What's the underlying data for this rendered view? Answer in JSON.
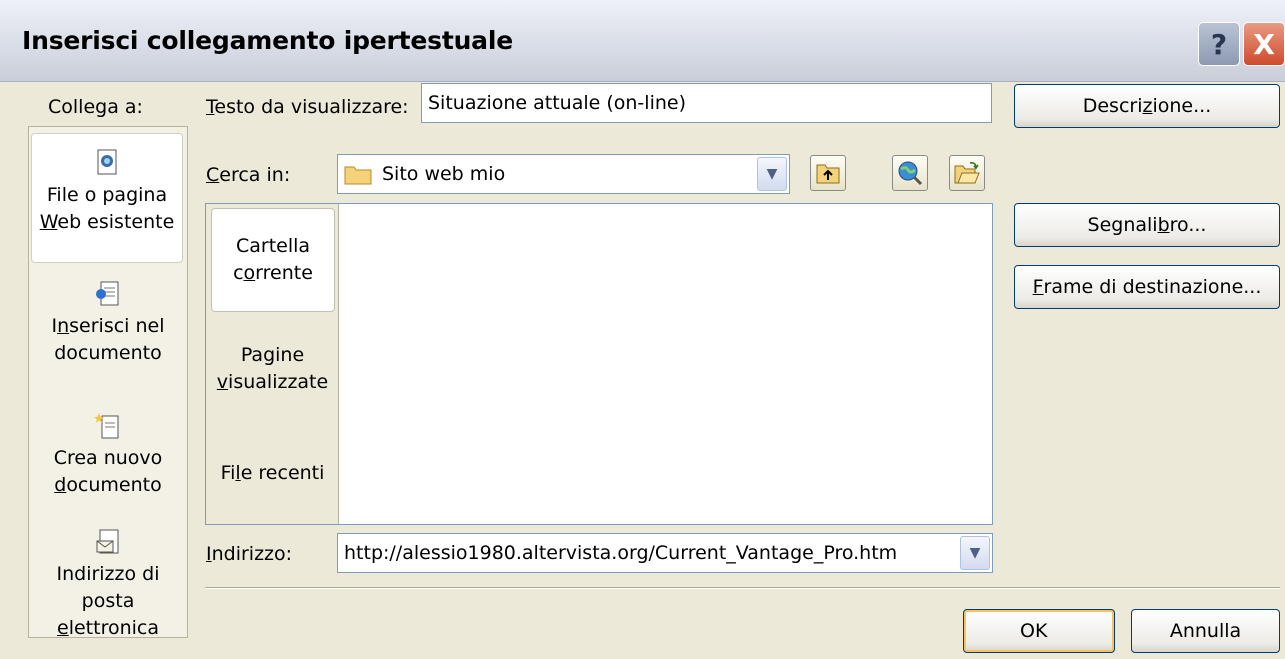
{
  "window": {
    "title": "Inserisci collegamento ipertestuale",
    "help_glyph": "?",
    "close_glyph": "X"
  },
  "linkbar": {
    "heading": "Collega a:",
    "items": [
      {
        "icon": "existing-file-icon",
        "line1": "File o pagina",
        "line2_accel": "W",
        "line2_rest": "eb esistente"
      },
      {
        "icon": "place-in-document-icon",
        "line1_pre": "I",
        "line1_accel": "n",
        "line1_rest": "serisci nel",
        "line2": "documento"
      },
      {
        "icon": "new-document-icon",
        "line1": "Crea nuovo",
        "line2_accel": "d",
        "line2_rest": "ocumento"
      },
      {
        "icon": "email-address-icon",
        "line1": "Indirizzo di",
        "line2": "posta",
        "line3_accel": "e",
        "line3_rest": "lettronica"
      }
    ]
  },
  "display_text": {
    "label_accel": "T",
    "label_rest": "esto da visualizzare:",
    "value": "Situazione attuale (on-line)"
  },
  "look_in": {
    "label_accel": "C",
    "label_rest": "erca in:",
    "value": "Sito web mio",
    "folder_icon": "folder-icon",
    "up_icon": "up-one-folder-icon",
    "browse_web_icon": "browse-web-icon",
    "browse_file_icon": "browse-file-icon"
  },
  "browse_tabs": [
    {
      "line1": "Cartella",
      "line2_pre": "c",
      "line2_accel": "o",
      "line2_rest": "rrente"
    },
    {
      "line1": "Pagine",
      "line2_accel": "v",
      "line2_rest": "isualizzate"
    },
    {
      "pre": "Fi",
      "accel": "l",
      "rest": "e recenti"
    }
  ],
  "address": {
    "label_accel": "I",
    "label_rest": "ndirizzo:",
    "value": "http://alessio1980.altervista.org/Current_Vantage_Pro.htm"
  },
  "buttons": {
    "description": {
      "pre": "Descri",
      "accel": "z",
      "rest": "ione..."
    },
    "bookmark": {
      "pre": "Segnali",
      "accel": "b",
      "rest": "ro..."
    },
    "target_frame": {
      "pre": "",
      "accel": "F",
      "rest": "rame di destinazione..."
    },
    "ok": "OK",
    "cancel": "Annulla"
  },
  "colors": {
    "dialog_bg": "#ece9d8",
    "button_border": "#003c74",
    "default_glow": "#f7c35e",
    "close_red": "#cf4a2b"
  }
}
